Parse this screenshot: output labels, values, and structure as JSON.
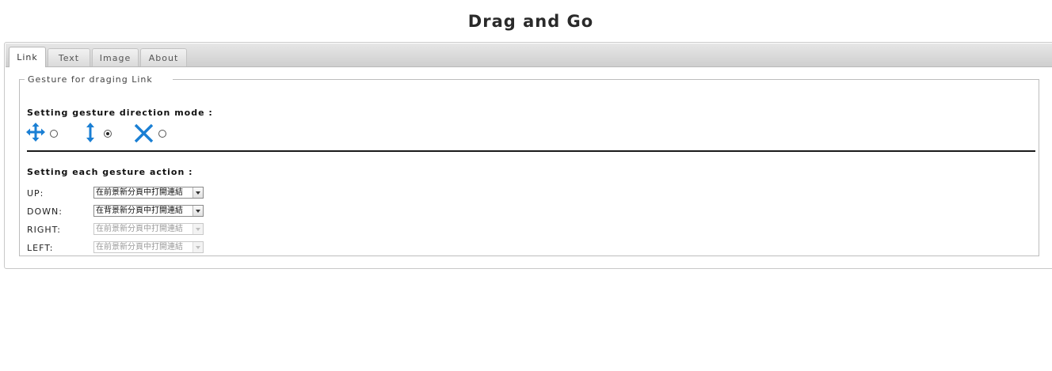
{
  "page": {
    "title": "Drag and Go"
  },
  "tabs": [
    {
      "label": "Link",
      "active": true
    },
    {
      "label": "Text",
      "active": false
    },
    {
      "label": "Image",
      "active": false
    },
    {
      "label": "About",
      "active": false
    }
  ],
  "link_panel": {
    "legend": "Gesture for draging Link",
    "direction_heading": "Setting gesture direction mode :",
    "direction_modes": [
      {
        "icon": "four-way-arrows-icon",
        "selected": false
      },
      {
        "icon": "vertical-arrows-icon",
        "selected": true
      },
      {
        "icon": "disable-x-icon",
        "selected": false
      }
    ],
    "action_heading": "Setting each gesture action :",
    "actions": [
      {
        "label": "UP:",
        "value": "在前景新分頁中打開連結",
        "enabled": true
      },
      {
        "label": "DOWN:",
        "value": "在背景新分頁中打開連結",
        "enabled": true
      },
      {
        "label": "RIGHT:",
        "value": "在前景新分頁中打開連結",
        "enabled": false
      },
      {
        "label": "LEFT:",
        "value": "在前景新分頁中打開連結",
        "enabled": false
      }
    ]
  },
  "colors": {
    "icon_blue": "#1a7fd4",
    "tabbar": "#d5d5d5"
  }
}
